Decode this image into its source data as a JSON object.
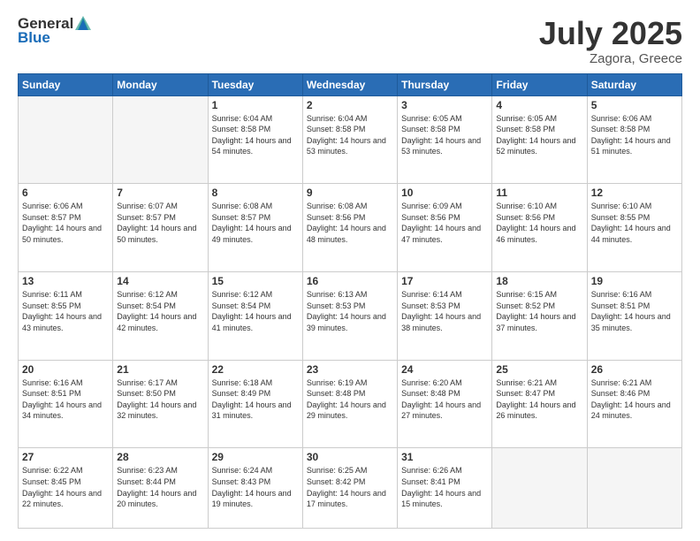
{
  "header": {
    "logo_general": "General",
    "logo_blue": "Blue",
    "month": "July 2025",
    "location": "Zagora, Greece"
  },
  "weekdays": [
    "Sunday",
    "Monday",
    "Tuesday",
    "Wednesday",
    "Thursday",
    "Friday",
    "Saturday"
  ],
  "weeks": [
    [
      {
        "day": "",
        "empty": true
      },
      {
        "day": "",
        "empty": true
      },
      {
        "day": "1",
        "sunrise": "6:04 AM",
        "sunset": "8:58 PM",
        "daylight": "14 hours and 54 minutes."
      },
      {
        "day": "2",
        "sunrise": "6:04 AM",
        "sunset": "8:58 PM",
        "daylight": "14 hours and 53 minutes."
      },
      {
        "day": "3",
        "sunrise": "6:05 AM",
        "sunset": "8:58 PM",
        "daylight": "14 hours and 53 minutes."
      },
      {
        "day": "4",
        "sunrise": "6:05 AM",
        "sunset": "8:58 PM",
        "daylight": "14 hours and 52 minutes."
      },
      {
        "day": "5",
        "sunrise": "6:06 AM",
        "sunset": "8:58 PM",
        "daylight": "14 hours and 51 minutes."
      }
    ],
    [
      {
        "day": "6",
        "sunrise": "6:06 AM",
        "sunset": "8:57 PM",
        "daylight": "14 hours and 50 minutes."
      },
      {
        "day": "7",
        "sunrise": "6:07 AM",
        "sunset": "8:57 PM",
        "daylight": "14 hours and 50 minutes."
      },
      {
        "day": "8",
        "sunrise": "6:08 AM",
        "sunset": "8:57 PM",
        "daylight": "14 hours and 49 minutes."
      },
      {
        "day": "9",
        "sunrise": "6:08 AM",
        "sunset": "8:56 PM",
        "daylight": "14 hours and 48 minutes."
      },
      {
        "day": "10",
        "sunrise": "6:09 AM",
        "sunset": "8:56 PM",
        "daylight": "14 hours and 47 minutes."
      },
      {
        "day": "11",
        "sunrise": "6:10 AM",
        "sunset": "8:56 PM",
        "daylight": "14 hours and 46 minutes."
      },
      {
        "day": "12",
        "sunrise": "6:10 AM",
        "sunset": "8:55 PM",
        "daylight": "14 hours and 44 minutes."
      }
    ],
    [
      {
        "day": "13",
        "sunrise": "6:11 AM",
        "sunset": "8:55 PM",
        "daylight": "14 hours and 43 minutes."
      },
      {
        "day": "14",
        "sunrise": "6:12 AM",
        "sunset": "8:54 PM",
        "daylight": "14 hours and 42 minutes."
      },
      {
        "day": "15",
        "sunrise": "6:12 AM",
        "sunset": "8:54 PM",
        "daylight": "14 hours and 41 minutes."
      },
      {
        "day": "16",
        "sunrise": "6:13 AM",
        "sunset": "8:53 PM",
        "daylight": "14 hours and 39 minutes."
      },
      {
        "day": "17",
        "sunrise": "6:14 AM",
        "sunset": "8:53 PM",
        "daylight": "14 hours and 38 minutes."
      },
      {
        "day": "18",
        "sunrise": "6:15 AM",
        "sunset": "8:52 PM",
        "daylight": "14 hours and 37 minutes."
      },
      {
        "day": "19",
        "sunrise": "6:16 AM",
        "sunset": "8:51 PM",
        "daylight": "14 hours and 35 minutes."
      }
    ],
    [
      {
        "day": "20",
        "sunrise": "6:16 AM",
        "sunset": "8:51 PM",
        "daylight": "14 hours and 34 minutes."
      },
      {
        "day": "21",
        "sunrise": "6:17 AM",
        "sunset": "8:50 PM",
        "daylight": "14 hours and 32 minutes."
      },
      {
        "day": "22",
        "sunrise": "6:18 AM",
        "sunset": "8:49 PM",
        "daylight": "14 hours and 31 minutes."
      },
      {
        "day": "23",
        "sunrise": "6:19 AM",
        "sunset": "8:48 PM",
        "daylight": "14 hours and 29 minutes."
      },
      {
        "day": "24",
        "sunrise": "6:20 AM",
        "sunset": "8:48 PM",
        "daylight": "14 hours and 27 minutes."
      },
      {
        "day": "25",
        "sunrise": "6:21 AM",
        "sunset": "8:47 PM",
        "daylight": "14 hours and 26 minutes."
      },
      {
        "day": "26",
        "sunrise": "6:21 AM",
        "sunset": "8:46 PM",
        "daylight": "14 hours and 24 minutes."
      }
    ],
    [
      {
        "day": "27",
        "sunrise": "6:22 AM",
        "sunset": "8:45 PM",
        "daylight": "14 hours and 22 minutes."
      },
      {
        "day": "28",
        "sunrise": "6:23 AM",
        "sunset": "8:44 PM",
        "daylight": "14 hours and 20 minutes."
      },
      {
        "day": "29",
        "sunrise": "6:24 AM",
        "sunset": "8:43 PM",
        "daylight": "14 hours and 19 minutes."
      },
      {
        "day": "30",
        "sunrise": "6:25 AM",
        "sunset": "8:42 PM",
        "daylight": "14 hours and 17 minutes."
      },
      {
        "day": "31",
        "sunrise": "6:26 AM",
        "sunset": "8:41 PM",
        "daylight": "14 hours and 15 minutes."
      },
      {
        "day": "",
        "empty": true
      },
      {
        "day": "",
        "empty": true
      }
    ]
  ]
}
